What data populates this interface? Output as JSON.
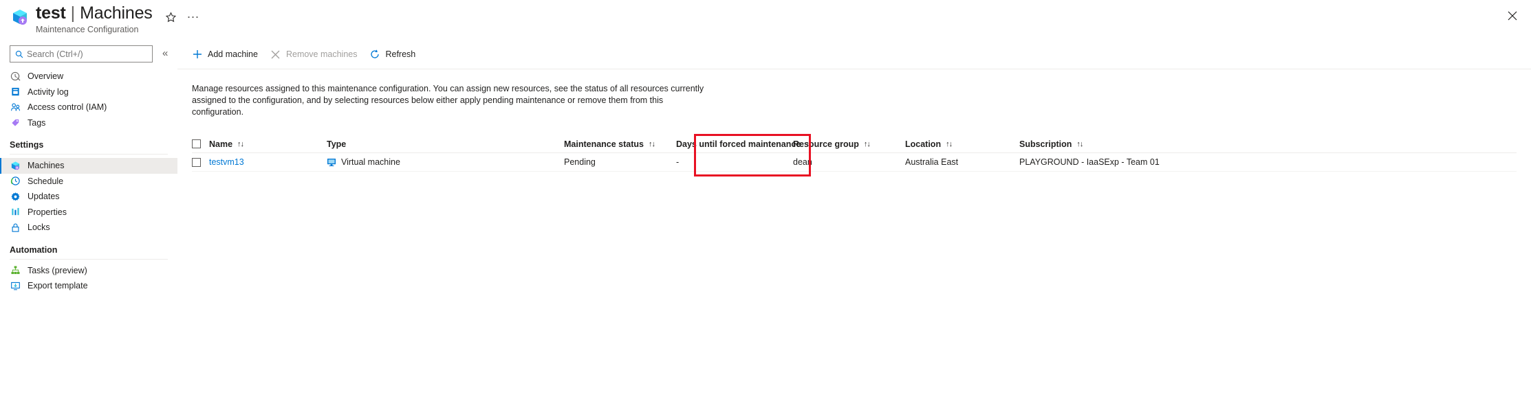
{
  "header": {
    "title_main": "test",
    "title_separator": "|",
    "title_sub": "Machines",
    "subtitle": "Maintenance Configuration",
    "star_icon": "star-icon",
    "ellipsis_icon": "ellipsis-icon",
    "close_icon": "close-icon"
  },
  "sidebar": {
    "search": {
      "placeholder": "Search (Ctrl+/)",
      "value": "",
      "icon": "search-icon"
    },
    "collapse_icon": "chevron-double-left-icon",
    "items": [
      {
        "label": "Overview",
        "icon": "overview-icon",
        "selected": false
      },
      {
        "label": "Activity log",
        "icon": "activity-log-icon",
        "selected": false
      },
      {
        "label": "Access control (IAM)",
        "icon": "access-control-icon",
        "selected": false
      },
      {
        "label": "Tags",
        "icon": "tags-icon",
        "selected": false
      }
    ],
    "sections": [
      {
        "title": "Settings",
        "items": [
          {
            "label": "Machines",
            "icon": "machines-icon",
            "selected": true
          },
          {
            "label": "Schedule",
            "icon": "schedule-clock-icon",
            "selected": false
          },
          {
            "label": "Updates",
            "icon": "updates-gear-icon",
            "selected": false
          },
          {
            "label": "Properties",
            "icon": "properties-bars-icon",
            "selected": false
          },
          {
            "label": "Locks",
            "icon": "lock-icon",
            "selected": false
          }
        ]
      },
      {
        "title": "Automation",
        "items": [
          {
            "label": "Tasks (preview)",
            "icon": "tasks-icon",
            "selected": false
          },
          {
            "label": "Export template",
            "icon": "export-template-icon",
            "selected": false
          }
        ]
      }
    ]
  },
  "toolbar": {
    "buttons": [
      {
        "label": "Add machine",
        "icon": "plus-icon",
        "disabled": false
      },
      {
        "label": "Remove machines",
        "icon": "cross-icon",
        "disabled": true
      },
      {
        "label": "Refresh",
        "icon": "refresh-icon",
        "disabled": false
      }
    ]
  },
  "description": "Manage resources assigned to this maintenance configuration. You can assign new resources, see the status of all resources currently assigned to the configuration, and by selecting resources below either apply pending maintenance or remove them from this configuration.",
  "table": {
    "select_all_checkbox": false,
    "sort_icon": "sort-arrows-icon",
    "columns": [
      {
        "label": "Name",
        "sortable": true,
        "key": "c-name"
      },
      {
        "label": "Type",
        "sortable": false,
        "key": "c-type"
      },
      {
        "label": "Maintenance status",
        "sortable": true,
        "key": "c-status"
      },
      {
        "label": "Days until forced maintenance",
        "sortable": true,
        "key": "c-days"
      },
      {
        "label": "Resource group",
        "sortable": true,
        "key": "c-rg"
      },
      {
        "label": "Location",
        "sortable": true,
        "key": "c-loc"
      },
      {
        "label": "Subscription",
        "sortable": true,
        "key": "c-sub"
      }
    ],
    "rows": [
      {
        "checked": false,
        "name": "testvm13",
        "type": "Virtual machine",
        "type_icon": "virtual-machine-icon",
        "maintenance_status": "Pending",
        "days_until_forced": "-",
        "resource_group": "dean",
        "location": "Australia East",
        "subscription": "PLAYGROUND - IaaSExp - Team 01"
      }
    ]
  },
  "annotation": {
    "color": "#e81123",
    "label": "maintenance-status-highlight"
  },
  "colors": {
    "accent": "#0078d4",
    "link": "#0078d4",
    "selected_bg": "#edebe9",
    "disabled_text": "#a19f9d",
    "annotation_red": "#e81123"
  }
}
